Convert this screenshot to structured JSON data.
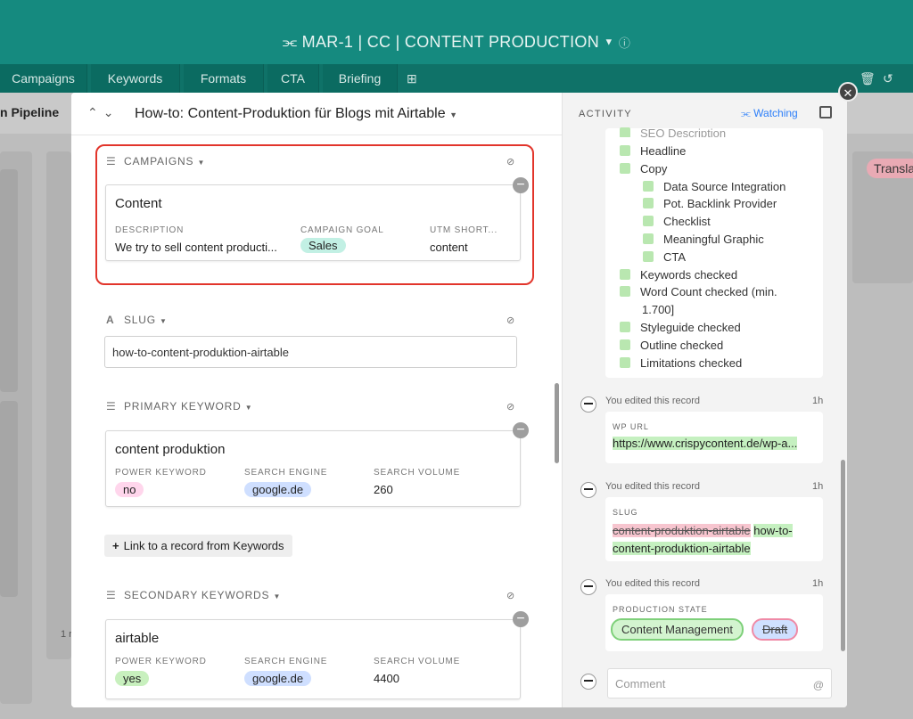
{
  "app": {
    "title": "MAR-1 | CC | CONTENT PRODUCTION",
    "tabs": [
      "Campaigns",
      "Keywords",
      "Formats",
      "CTA",
      "Briefing"
    ],
    "view_name": "n Pipeline",
    "bg_tag": "Transla",
    "bg_card_count": "1 r"
  },
  "record": {
    "title": "How-to: Content-Produktion für Blogs mit Airtable",
    "campaigns": {
      "label": "CAMPAIGNS",
      "card": {
        "title": "Content",
        "description_label": "DESCRIPTION",
        "description": "We try to sell content producti...",
        "goal_label": "CAMPAIGN GOAL",
        "goal": "Sales",
        "utm_label": "UTM SHORT...",
        "utm": "content"
      }
    },
    "slug": {
      "label": "SLUG",
      "value": "how-to-content-produktion-airtable"
    },
    "primary_keyword": {
      "label": "PRIMARY KEYWORD",
      "card": {
        "title": "content produktion",
        "power_label": "POWER KEYWORD",
        "power": "no",
        "engine_label": "SEARCH ENGINE",
        "engine": "google.de",
        "volume_label": "SEARCH VOLUME",
        "volume": "260"
      },
      "link_button": "Link to a record from Keywords"
    },
    "secondary_keywords": {
      "label": "SECONDARY KEYWORDS",
      "card": {
        "title": "airtable",
        "power_label": "POWER KEYWORD",
        "power": "yes",
        "engine_label": "SEARCH ENGINE",
        "engine": "google.de",
        "volume_label": "SEARCH VOLUME",
        "volume": "4400"
      }
    }
  },
  "activity": {
    "label": "ACTIVITY",
    "watching": "Watching",
    "partial_item": "SEO Description",
    "checklist": [
      {
        "text": "Headline",
        "indent": 0
      },
      {
        "text": "Copy",
        "indent": 0
      },
      {
        "text": "Data Source Integration",
        "indent": 1
      },
      {
        "text": "Pot. Backlink Provider",
        "indent": 1
      },
      {
        "text": "Checklist",
        "indent": 1
      },
      {
        "text": "Meaningful Graphic",
        "indent": 1
      },
      {
        "text": "CTA",
        "indent": 1
      },
      {
        "text": "Keywords checked",
        "indent": 0
      },
      {
        "text": "Word Count checked (min.",
        "indent": 0
      },
      {
        "text": "1.700]",
        "indent": 0,
        "continuation": true
      },
      {
        "text": "Styleguide checked",
        "indent": 0
      },
      {
        "text": "Outline checked",
        "indent": 0
      },
      {
        "text": "Limitations checked",
        "indent": 0
      }
    ],
    "edits": [
      {
        "who": "You edited this record",
        "time": "1h",
        "field": "WP URL",
        "new": "https://www.crispycontent.de/wp-a..."
      },
      {
        "who": "You edited this record",
        "time": "1h",
        "field": "SLUG",
        "old": "content-produktion-airtable",
        "new_1": "how-to-",
        "new_2": "content-produktion-airtable"
      },
      {
        "who": "You edited this record",
        "time": "1h",
        "field": "PRODUCTION STATE",
        "new": "Content Management",
        "old": "Draft"
      }
    ],
    "comment_placeholder": "Comment",
    "comment_at": "@"
  },
  "colors": {
    "brand": "#158a7f",
    "highlight_box": "#e2352b",
    "link_blue": "#2d7ff9",
    "added": "#c5f0c0",
    "removed": "#f7c5cf"
  }
}
